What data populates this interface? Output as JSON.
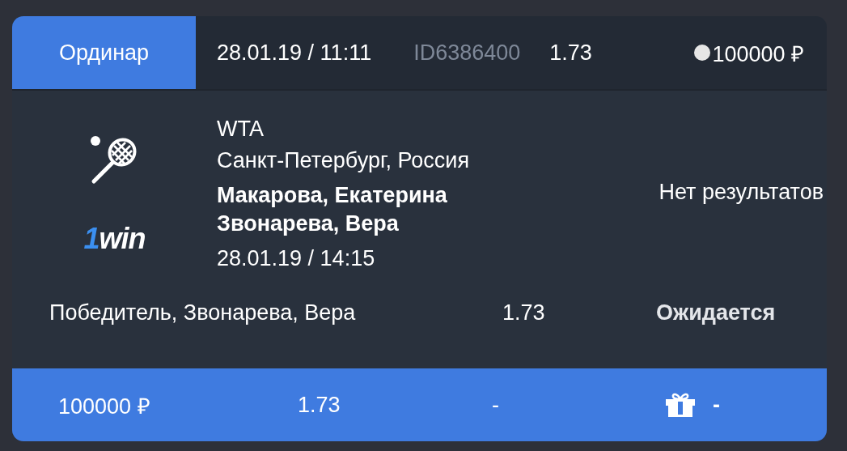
{
  "header": {
    "tabs": [
      {
        "label": "Ординар",
        "selected": true
      }
    ],
    "datetime": "28.01.19 / 11:11",
    "bet_id": "ID6386400",
    "odds": "1.73",
    "stake": "100000 ₽"
  },
  "event": {
    "logo": {
      "accent": "1",
      "rest": "win"
    },
    "league": "WTA",
    "location": "Санкт-Петербург, Россия",
    "players": [
      "Макарова, Екатерина",
      "Звонарева, Вера"
    ],
    "datetime": "28.01.19 / 14:15",
    "result": "Нет результатов"
  },
  "selection": {
    "outcome": "Победитель, Звонарева, Вера",
    "odds": "1.73",
    "status": "Ожидается"
  },
  "footer": {
    "stake": "100000 ₽",
    "odds": "1.73",
    "win": "-",
    "bonus": "-"
  }
}
